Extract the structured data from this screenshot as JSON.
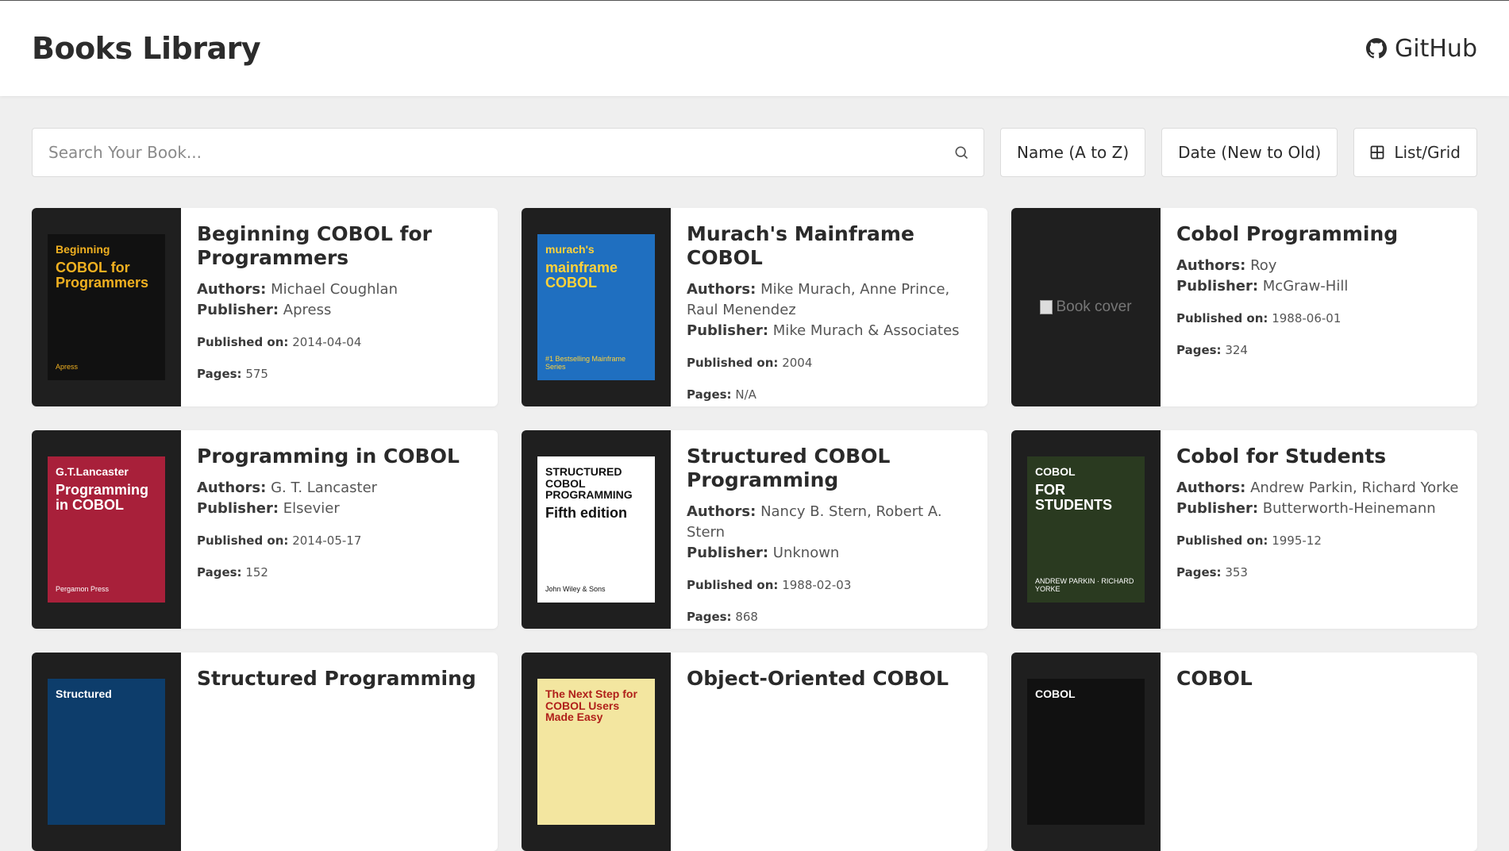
{
  "header": {
    "title": "Books Library",
    "github_label": "GitHub"
  },
  "toolbar": {
    "search_placeholder": "Search Your Book...",
    "sort_name_label": "Name (A to Z)",
    "sort_date_label": "Date (New to Old)",
    "view_toggle_label": "List/Grid"
  },
  "labels": {
    "authors": "Authors:",
    "publisher": "Publisher:",
    "published_on": "Published on:",
    "pages": "Pages:"
  },
  "books": [
    {
      "title": "Beginning COBOL for Programmers",
      "authors": "Michael Coughlan",
      "publisher": "Apress",
      "published_on": "2014-04-04",
      "pages": "575",
      "cover": {
        "line1": "Beginning",
        "line2": "COBOL for Programmers",
        "foot": "Apress",
        "bg": "#111111",
        "fg": "#f0b020"
      }
    },
    {
      "title": "Murach's Mainframe COBOL",
      "authors": "Mike Murach, Anne Prince, Raul Menendez",
      "publisher": "Mike Murach & Associates",
      "published_on": "2004",
      "pages": "N/A",
      "cover": {
        "line1": "murach's",
        "line2": "mainframe COBOL",
        "foot": "#1 Bestselling Mainframe Series",
        "bg": "#1f6fc0",
        "fg": "#ffd23a"
      }
    },
    {
      "title": "Cobol Programming",
      "authors": "Roy",
      "publisher": "McGraw-Hill",
      "published_on": "1988-06-01",
      "pages": "324",
      "cover": {
        "broken_alt": "Book cover"
      }
    },
    {
      "title": "Programming in COBOL",
      "authors": "G. T. Lancaster",
      "publisher": "Elsevier",
      "published_on": "2014-05-17",
      "pages": "152",
      "cover": {
        "line1": "G.T.Lancaster",
        "line2": "Programming in COBOL",
        "foot": "Pergamon Press",
        "bg": "#a8203a",
        "fg": "#ffffff"
      }
    },
    {
      "title": "Structured COBOL Programming",
      "authors": "Nancy B. Stern, Robert A. Stern",
      "publisher": "Unknown",
      "published_on": "1988-02-03",
      "pages": "868",
      "cover": {
        "line1": "STRUCTURED COBOL PROGRAMMING",
        "line2": "Fifth edition",
        "foot": "John Wiley & Sons",
        "bg": "#ffffff",
        "fg": "#111111"
      }
    },
    {
      "title": "Cobol for Students",
      "authors": "Andrew Parkin, Richard Yorke",
      "publisher": "Butterworth-Heinemann",
      "published_on": "1995-12",
      "pages": "353",
      "cover": {
        "line1": "COBOL",
        "line2": "FOR STUDENTS",
        "foot": "ANDREW PARKIN · RICHARD YORKE",
        "bg": "#2a3a20",
        "fg": "#ffffff"
      }
    },
    {
      "title": "Structured Programming",
      "authors": "",
      "publisher": "",
      "published_on": "",
      "pages": "",
      "cover": {
        "line1": "Structured",
        "line2": "",
        "foot": "",
        "bg": "#0d3d6b",
        "fg": "#ffffff"
      }
    },
    {
      "title": "Object-Oriented COBOL",
      "authors": "",
      "publisher": "",
      "published_on": "",
      "pages": "",
      "cover": {
        "line1": "The Next Step for COBOL Users Made Easy",
        "line2": "",
        "foot": "",
        "bg": "#f3e6a0",
        "fg": "#b0201a"
      }
    },
    {
      "title": "COBOL",
      "authors": "",
      "publisher": "",
      "published_on": "",
      "pages": "",
      "cover": {
        "line1": "COBOL",
        "line2": "",
        "foot": "",
        "bg": "#111111",
        "fg": "#ffffff"
      }
    }
  ]
}
